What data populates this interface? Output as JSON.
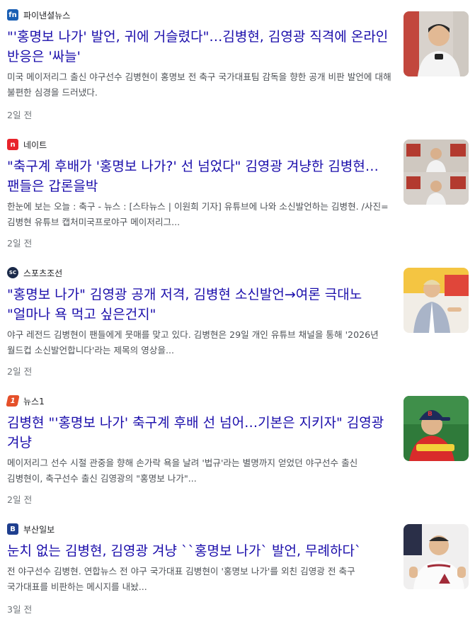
{
  "articles": [
    {
      "source": "파이낸셜뉴스",
      "logo_text": "fn",
      "logo_color": "#1a5fb4",
      "headline": "\"'홍명보 나가' 발언, 귀에 거슬렸다\"…김병현, 김영광 직격에 온라인 반응은 '싸늘'",
      "snippet": "미국 메이저리그 출신 야구선수 김병현이 홍명보 전 축구 국가대표팀 감독을 향한 공개 비판 발언에 대해 불편한 심경을 드러냈다.",
      "time": "2일 전",
      "thumb_icon": "person-photo-thumbnail"
    },
    {
      "source": "네이트",
      "logo_text": "n",
      "logo_color": "#e8242b",
      "headline": "\"축구계 후배가 '홍명보 나가?' 선 넘었다\" 김영광 겨냥한 김병현… 팬들은 갑론을박",
      "snippet": "한눈에 보는 오늘 : 축구 - 뉴스 : [스타뉴스 | 이원희 기자] 유튜브에 나와 소신발언하는 김병현. /사진=김병현 유튜브 캡처미국프로야구 메이저리그...",
      "time": "2일 전",
      "thumb_icon": "video-capture-thumbnail"
    },
    {
      "source": "스포츠조선",
      "logo_text": "SC",
      "logo_color": "#1b2a4a",
      "headline": "\"홍명보 나가\" 김영광 공개 저격, 김병현 소신발언→여론 극대노 \"얼마나 욕 먹고 싶은건지\"",
      "snippet": "야구 레전드 김병현이 팬들에게 뭇매를 맞고 있다. 김병현은 29일 개인 유튜브 채널을 통해 '2026년 월드컵 소신발언합니다'라는 제목의 영상을...",
      "time": "2일 전",
      "thumb_icon": "speaker-photo-thumbnail"
    },
    {
      "source": "뉴스1",
      "logo_text": "1",
      "logo_color": "#e5502a",
      "headline": "김병현 \"'홍명보 나가' 축구계 후배 선 넘어…기본은 지키자\" 김영광 겨냥",
      "snippet": "메이저리그 선수 시절 관중을 향해 손가락 욕을 날려 '법규'라는 별명까지 얻었던 야구선수 출신 김병현이, 축구선수 출신 김영광의 \"홍명보 나가\"...",
      "time": "2일 전",
      "thumb_icon": "cap-person-thumbnail"
    },
    {
      "source": "부산일보",
      "logo_text": "B",
      "logo_color": "#1f3f8f",
      "headline": "눈치 없는 김병현, 김영광 겨냥 ``홍명보 나가` 발언, 무례하다`",
      "snippet": "전 야구선수 김병현. 연합뉴스 전 야구 국가대표 김병현이 '홍명보 나가'를 외친 김영광 전 축구 국가대표를 비판하는 메시지를 내놨...",
      "time": "3일 전",
      "thumb_icon": "jersey-person-thumbnail"
    }
  ]
}
